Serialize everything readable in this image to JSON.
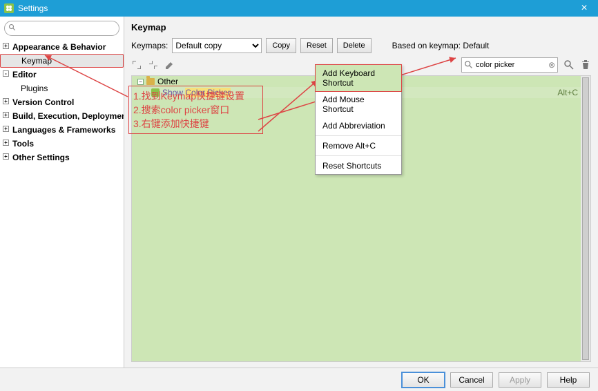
{
  "window": {
    "title": "Settings"
  },
  "sidebar": {
    "search_placeholder": "",
    "items": [
      {
        "label": "Appearance & Behavior",
        "type": "top",
        "expand": "+"
      },
      {
        "label": "Keymap",
        "type": "child",
        "selected": true
      },
      {
        "label": "Editor",
        "type": "top",
        "expand": "-"
      },
      {
        "label": "Plugins",
        "type": "child"
      },
      {
        "label": "Version Control",
        "type": "top",
        "expand": "+"
      },
      {
        "label": "Build, Execution, Deployment",
        "type": "top",
        "expand": "+"
      },
      {
        "label": "Languages & Frameworks",
        "type": "top",
        "expand": "+"
      },
      {
        "label": "Tools",
        "type": "top",
        "expand": "+"
      },
      {
        "label": "Other Settings",
        "type": "top",
        "expand": "+"
      }
    ]
  },
  "keymap": {
    "panel_title": "Keymap",
    "keymaps_label": "Keymaps:",
    "keymaps_value": "Default copy",
    "buttons": {
      "copy": "Copy",
      "reset": "Reset",
      "delete": "Delete"
    },
    "based_label": "Based on keymap:",
    "based_value": "Default",
    "filter_value": "color picker",
    "toolbar_icons": [
      "expand-all-icon",
      "collapse-all-icon",
      "edit-icon"
    ],
    "tree": {
      "root_label": "Other",
      "item_prefix": "Show",
      "item_highlight": "Color Picker",
      "shortcut": "Alt+C"
    }
  },
  "context_menu": {
    "items": [
      "Add Keyboard Shortcut",
      "Add Mouse Shortcut",
      "Add Abbreviation",
      "Remove Alt+C",
      "Reset Shortcuts"
    ],
    "selected_index": 0
  },
  "annotation": {
    "line1": "1.找到Keymap快捷键设置",
    "line2": "2.搜索color picker窗口",
    "line3": "3.右键添加快捷键"
  },
  "footer": {
    "ok": "OK",
    "cancel": "Cancel",
    "apply": "Apply",
    "help": "Help"
  }
}
